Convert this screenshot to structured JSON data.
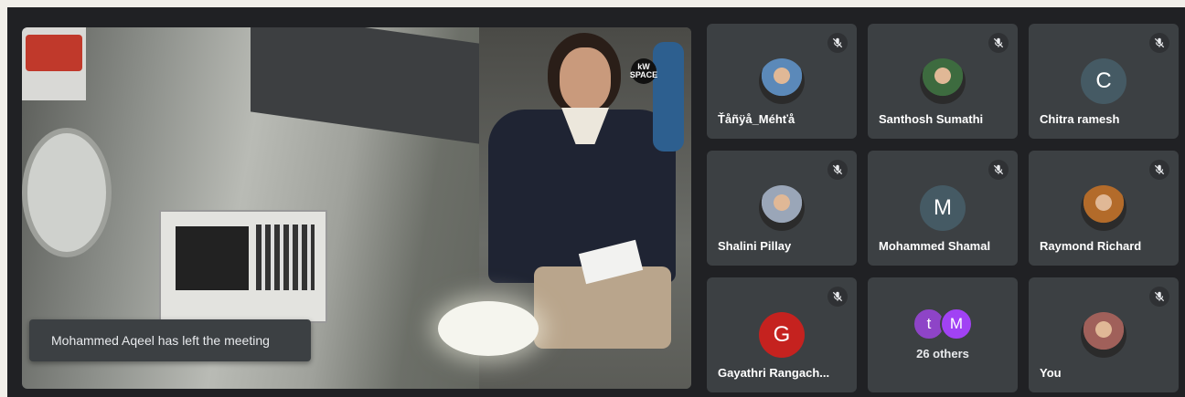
{
  "presenter": {
    "notification": "Mohammed Aqeel has left the meeting",
    "watermark": "kW SPACE"
  },
  "participants": [
    {
      "name": "Ťåñÿå_Méhťå",
      "avatar_type": "photo",
      "avatar_color": "#5b89b9",
      "muted": true
    },
    {
      "name": "Santhosh Sumathi",
      "avatar_type": "photo",
      "avatar_color": "#3d6b3f",
      "muted": true
    },
    {
      "name": "Chitra ramesh",
      "avatar_type": "initial",
      "initial": "C",
      "avatar_color": "#455a64",
      "muted": true
    },
    {
      "name": "Shalini Pillay",
      "avatar_type": "photo",
      "avatar_color": "#9aa6b8",
      "muted": true
    },
    {
      "name": "Mohammed Shamal",
      "avatar_type": "initial",
      "initial": "M",
      "avatar_color": "#455a64",
      "muted": true
    },
    {
      "name": "Raymond Richard",
      "avatar_type": "photo",
      "avatar_color": "#b36b2a",
      "muted": true
    },
    {
      "name": "Gayathri Rangach...",
      "avatar_type": "initial",
      "initial": "G",
      "avatar_color": "#c5221f",
      "muted": true
    },
    {
      "name": "You",
      "avatar_type": "photo",
      "avatar_color": "#a0605a",
      "muted": true
    }
  ],
  "others": {
    "label": "26 others",
    "initials": [
      "t",
      "M"
    ],
    "colors": [
      "#8e44c7",
      "#a142f4"
    ]
  }
}
